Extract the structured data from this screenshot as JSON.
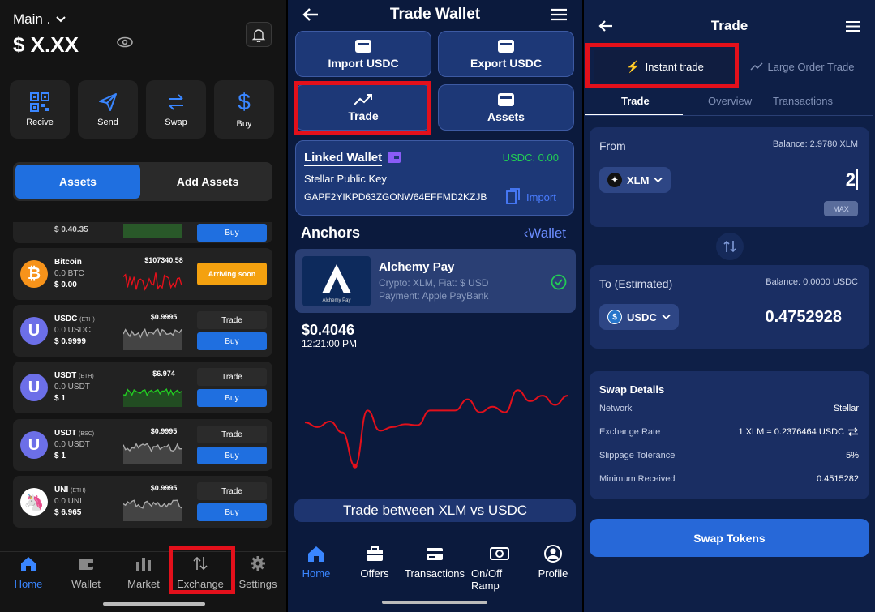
{
  "wallet_home": {
    "account_label": "Main .",
    "balance": "$ X.XX",
    "actions": [
      {
        "label": "Recive",
        "icon": "qr-code-icon"
      },
      {
        "label": "Send",
        "icon": "send-icon"
      },
      {
        "label": "Swap",
        "icon": "swap-icon"
      },
      {
        "label": "Buy",
        "icon": "dollar-icon"
      }
    ],
    "tabs": {
      "assets": "Assets",
      "add_assets": "Add Assets"
    },
    "partial_row": {
      "value": "$ 0.40.35",
      "buy": "Buy"
    },
    "assets": [
      {
        "name": "Bitcoin",
        "net": "",
        "amount": "0.0 BTC",
        "value": "$ 0.00",
        "price": "$107340.58",
        "trade": "",
        "buy": "",
        "soon": "Arriving soon",
        "color": "#f7931a",
        "symbol": "₿",
        "spark": "#e3101b"
      },
      {
        "name": "USDC",
        "net": "(ETH)",
        "amount": "0.0 USDC",
        "value": "$ 0.9999",
        "price": "$0.9995",
        "trade": "Trade",
        "buy": "Buy",
        "soon": "",
        "color": "#6c6fe8",
        "symbol": "U",
        "spark": "#aaaaaa"
      },
      {
        "name": "USDT",
        "net": "(ETH)",
        "amount": "0.0 USDT",
        "value": "$ 1",
        "price": "$6.974",
        "trade": "Trade",
        "buy": "Buy",
        "soon": "",
        "color": "#6c6fe8",
        "symbol": "U",
        "spark": "#22cc22"
      },
      {
        "name": "USDT",
        "net": "(BSC)",
        "amount": "0.0 USDT",
        "value": "$ 1",
        "price": "$0.9995",
        "trade": "Trade",
        "buy": "Buy",
        "soon": "",
        "color": "#6c6fe8",
        "symbol": "U",
        "spark": "#aaaaaa"
      },
      {
        "name": "UNI",
        "net": "(ETH)",
        "amount": "0.0 UNI",
        "value": "$ 6.965",
        "price": "$0.9995",
        "trade": "Trade",
        "buy": "Buy",
        "soon": "",
        "color": "#ffffff",
        "symbol": "🦄",
        "spark": "#aaaaaa"
      }
    ],
    "nav": [
      {
        "label": "Home",
        "icon": "home-icon",
        "active": true
      },
      {
        "label": "Wallet",
        "icon": "wallet-icon",
        "active": false
      },
      {
        "label": "Market",
        "icon": "bar-chart-icon",
        "active": false
      },
      {
        "label": "Exchange",
        "icon": "exchange-icon",
        "active": false
      },
      {
        "label": "Settings",
        "icon": "gear-icon",
        "active": false
      }
    ]
  },
  "trade_wallet": {
    "title": "Trade Wallet",
    "buttons": [
      {
        "label": "Import USDC",
        "icon": "wallet-icon"
      },
      {
        "label": "Export USDC",
        "icon": "wallet-icon"
      },
      {
        "label": "Trade",
        "icon": "trend-icon"
      },
      {
        "label": "Assets",
        "icon": "wallet-icon"
      }
    ],
    "linked": {
      "title": "Linked Wallet",
      "usdc": "USDC: 0.00",
      "key_label": "Stellar Public Key",
      "key": "GAPF2YIKPD63ZGONW64EFFMD2KZJB",
      "import": "Import"
    },
    "anchors_title": "Anchors",
    "wallet_link": "Wallet",
    "anchor": {
      "name": "Alchemy Pay",
      "logo_text": "Alchemy Pay",
      "crypto": "Crypto: XLM, Fiat: $ USD",
      "payment": "Payment: Apple PayBank"
    },
    "price": "$0.4046",
    "time": "12:21:00 PM",
    "chart_line": [
      0.49,
      0.44,
      0.5,
      0.38,
      0.02,
      0.62,
      0.4,
      0.44,
      0.47,
      0.46,
      0.62,
      0.62,
      0.62,
      0.74,
      0.6,
      0.66,
      0.6,
      0.84,
      0.72,
      0.78,
      0.68,
      0.78
    ],
    "caption": "Trade between XLM  vs  USDC",
    "nav": [
      {
        "label": "Home",
        "icon": "home-icon",
        "active": true
      },
      {
        "label": "Offers",
        "icon": "briefcase-icon",
        "active": false
      },
      {
        "label": "Transactions",
        "icon": "card-icon",
        "active": false
      },
      {
        "label": "On/Off Ramp",
        "icon": "cash-icon",
        "active": false
      },
      {
        "label": "Profile",
        "icon": "profile-icon",
        "active": false
      }
    ]
  },
  "trade": {
    "title": "Trade",
    "modes": {
      "instant": "Instant trade",
      "large": "Large Order Trade"
    },
    "subtabs": [
      "Trade",
      "Overview",
      "Transactions"
    ],
    "from": {
      "label": "From",
      "balance": "Balance: 2.9780 XLM",
      "token": "XLM",
      "amount": "2",
      "max": "MAX"
    },
    "to": {
      "label": "To (Estimated)",
      "balance": "Balance: 0.0000 USDC",
      "token": "USDC",
      "amount": "0.4752928"
    },
    "details": {
      "title": "Swap Details",
      "rows": [
        {
          "label": "Network",
          "value": "Stellar"
        },
        {
          "label": "Exchange Rate",
          "value": "1 XLM = 0.2376464 USDC"
        },
        {
          "label": "Slippage Tolerance",
          "value": "5%"
        },
        {
          "label": "Minimum Received",
          "value": "0.4515282"
        }
      ]
    },
    "swap_button": "Swap Tokens"
  }
}
